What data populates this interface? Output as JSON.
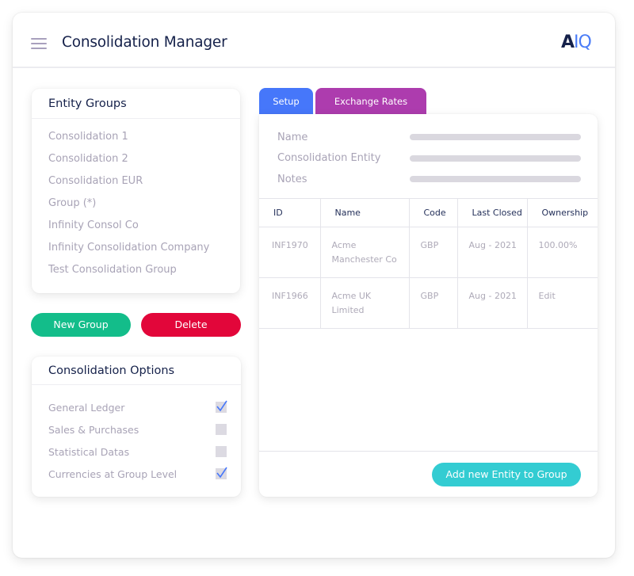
{
  "header": {
    "title": "Consolidation Manager",
    "logo_part1": "A",
    "logo_part2": "IQ"
  },
  "entity_groups": {
    "title": "Entity Groups",
    "items": [
      "Consolidation 1",
      "Consolidation 2",
      "Consolidation EUR",
      "Group (*)",
      "Infinity Consol Co",
      "Infinity Consolidation Company",
      "Test Consolidation Group"
    ]
  },
  "actions": {
    "new_group": "New Group",
    "delete": "Delete"
  },
  "consolidation_options": {
    "title": "Consolidation Options",
    "options": [
      {
        "label": "General Ledger",
        "checked": true
      },
      {
        "label": "Sales & Purchases",
        "checked": false
      },
      {
        "label": "Statistical Datas",
        "checked": false
      },
      {
        "label": "Currencies at Group Level",
        "checked": true
      }
    ]
  },
  "tabs": [
    {
      "label": "Setup",
      "active": true
    },
    {
      "label": "Exchange Rates",
      "active": false
    }
  ],
  "setup": {
    "fields": [
      {
        "label": "Name",
        "value": ""
      },
      {
        "label": "Consolidation Entity",
        "value": ""
      },
      {
        "label": "Notes",
        "value": ""
      }
    ],
    "table": {
      "columns": [
        "ID",
        "Name",
        "Code",
        "Last Closed",
        "Ownership"
      ],
      "rows": [
        [
          "INF1970",
          "Acme Manchester Co",
          "GBP",
          "Aug - 2021",
          "100.00%"
        ],
        [
          "INF1966",
          "Acme UK Limited",
          "GBP",
          "Aug - 2021",
          "Edit"
        ]
      ]
    },
    "add_button": "Add new Entity to Group"
  },
  "colors": {
    "new_group": "#13bd8a",
    "delete": "#e2063a",
    "tab_setup": "#4677fa",
    "tab_rates": "#ad3cae",
    "add_entity": "#33ccd2",
    "title_text": "#15214a",
    "check": "#4677fa"
  }
}
